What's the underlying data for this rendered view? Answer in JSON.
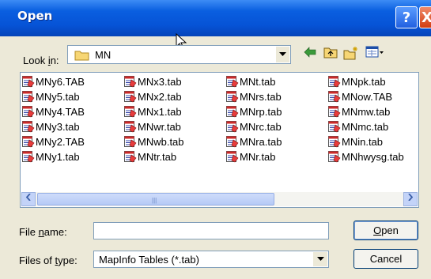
{
  "window": {
    "title": "Open",
    "help_glyph": "?",
    "close_glyph": "X",
    "title_color": "#0a5fe0"
  },
  "look_in": {
    "label_pre": "Look ",
    "label_ul": "i",
    "label_post": "n:",
    "value": "MN",
    "icon": "folder-icon"
  },
  "toolbar": {
    "icons": [
      "back-icon",
      "up-folder-icon",
      "new-folder-icon",
      "view-menu-icon"
    ]
  },
  "files": {
    "col1": [
      "MNy6.TAB",
      "MNy5.tab",
      "MNy4.TAB",
      "MNy3.tab",
      "MNy2.TAB",
      "MNy1.tab"
    ],
    "col2": [
      "MNx3.tab",
      "MNx2.tab",
      "MNx1.tab",
      "MNwr.tab",
      "MNwb.tab",
      "MNtr.tab"
    ],
    "col3": [
      "MNt.tab",
      "MNrs.tab",
      "MNrp.tab",
      "MNrc.tab",
      "MNra.tab",
      "MNr.tab"
    ],
    "col4": [
      "MNpk.tab",
      "MNow.TAB",
      "MNmw.tab",
      "MNmc.tab",
      "MNin.tab",
      "MNhwysg.tab"
    ]
  },
  "file_name": {
    "label_pre": "File ",
    "label_ul": "n",
    "label_post": "ame:",
    "value": ""
  },
  "file_type": {
    "label_pre": "Files of ",
    "label_ul": "t",
    "label_post": "ype:",
    "value": "MapInfo Tables (*.tab)"
  },
  "buttons": {
    "open_ul": "O",
    "open_rest": "pen",
    "cancel": "Cancel"
  }
}
